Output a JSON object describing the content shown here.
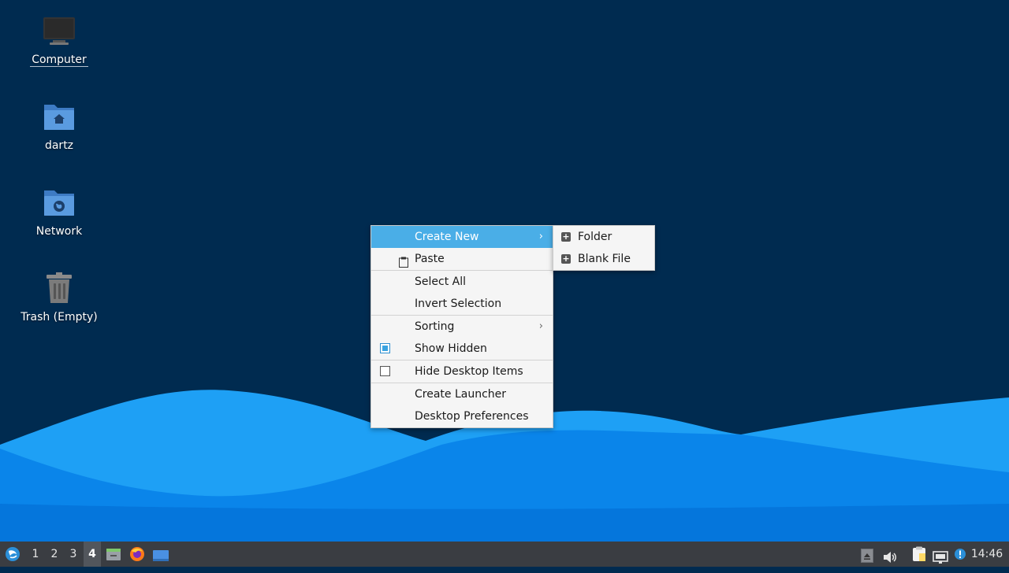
{
  "desktop": {
    "icons": [
      {
        "label": "Computer",
        "icon": "computer-icon"
      },
      {
        "label": "dartz",
        "icon": "home-folder-icon"
      },
      {
        "label": "Network",
        "icon": "network-folder-icon"
      },
      {
        "label": "Trash (Empty)",
        "icon": "trash-icon"
      }
    ],
    "wallpaper_colors": {
      "background": "#002b50",
      "wave_light": "#1ea0f5",
      "wave_mid": "#0a85ea",
      "wave_dark": "#0576dc"
    }
  },
  "context_menu": {
    "create_new": "Create New",
    "paste": "Paste",
    "select_all": "Select All",
    "invert_selection": "Invert Selection",
    "sorting": "Sorting",
    "show_hidden": "Show Hidden",
    "show_hidden_checked": true,
    "hide_desktop_items": "Hide Desktop Items",
    "hide_desktop_items_checked": false,
    "create_launcher": "Create Launcher",
    "desktop_preferences": "Desktop Preferences",
    "submenu_arrow": "›",
    "highlight_color": "#4aaee7"
  },
  "submenu": {
    "folder": "Folder",
    "blank_file": "Blank File"
  },
  "taskbar": {
    "workspaces": [
      "1",
      "2",
      "3",
      "4"
    ],
    "active_workspace": "4",
    "launchers": [
      "file-manager-icon",
      "firefox-icon",
      "show-desktop-icon"
    ],
    "tray": [
      "tray-arrow-icon",
      "volume-icon",
      "clipboard-icon",
      "network-icon",
      "notification-icon"
    ],
    "clock": "14:46"
  }
}
